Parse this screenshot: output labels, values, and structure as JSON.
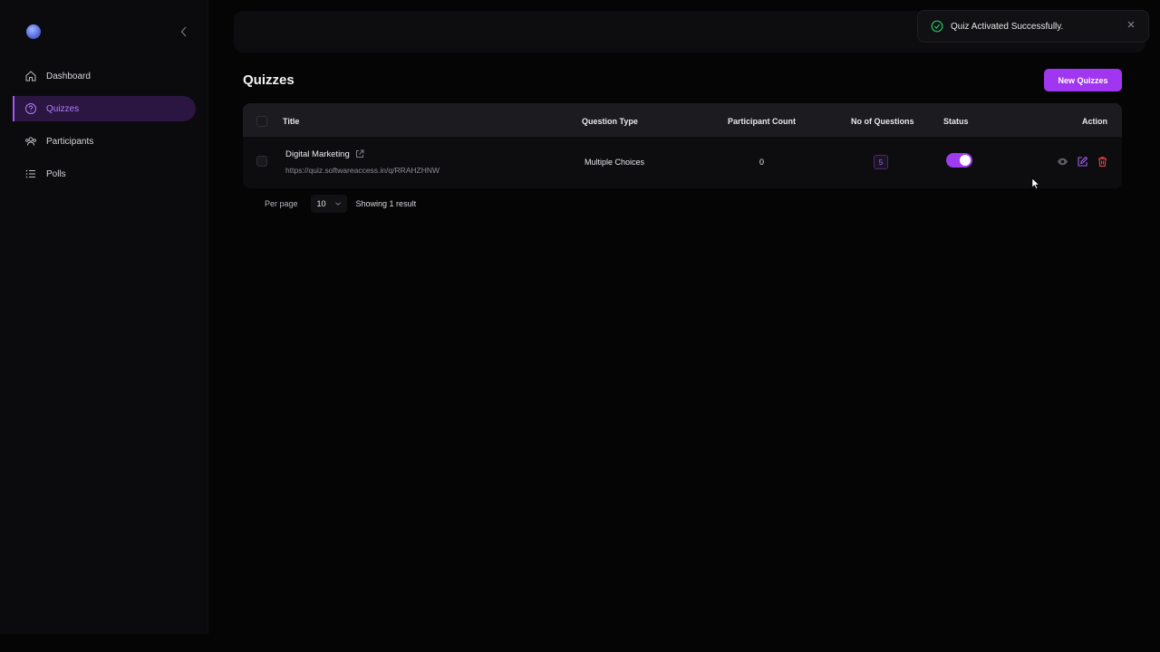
{
  "sidebar": {
    "items": [
      {
        "label": "Dashboard",
        "icon": "home-icon",
        "active": false
      },
      {
        "label": "Quizzes",
        "icon": "question-circle-icon",
        "active": true
      },
      {
        "label": "Participants",
        "icon": "users-icon",
        "active": false
      },
      {
        "label": "Polls",
        "icon": "list-icon",
        "active": false
      }
    ]
  },
  "toast": {
    "message": "Quiz Activated Successfully.",
    "icon": "check-circle-icon",
    "color": "#22c55e"
  },
  "page": {
    "title": "Quizzes",
    "new_button_label": "New Quizzes"
  },
  "table": {
    "columns": {
      "title": "Title",
      "question_type": "Question Type",
      "participant_count": "Participant Count",
      "no_of_questions": "No of Questions",
      "status": "Status",
      "action": "Action"
    },
    "rows": [
      {
        "title": "Digital Marketing",
        "url": "https://quiz.softwareaccess.in/q/RRAHZHNW",
        "question_type": "Multiple Choices",
        "participant_count": "0",
        "no_of_questions": "5",
        "status_active": true
      }
    ]
  },
  "pagination": {
    "per_page_label": "Per page",
    "per_page_value": "10",
    "showing": "Showing 1 result"
  },
  "colors": {
    "accent": "#a136f0",
    "delete": "#ef4444",
    "success": "#22c55e"
  }
}
